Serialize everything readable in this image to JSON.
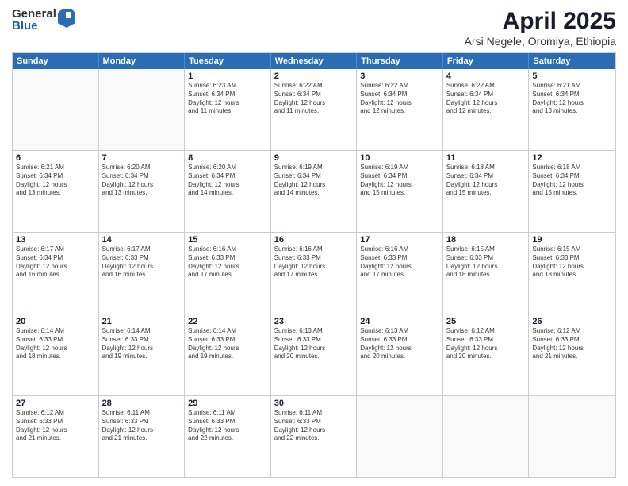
{
  "logo": {
    "general": "General",
    "blue": "Blue"
  },
  "title": "April 2025",
  "location": "Arsi Negele, Oromiya, Ethiopia",
  "header_days": [
    "Sunday",
    "Monday",
    "Tuesday",
    "Wednesday",
    "Thursday",
    "Friday",
    "Saturday"
  ],
  "weeks": [
    [
      {
        "day": "",
        "info": ""
      },
      {
        "day": "",
        "info": ""
      },
      {
        "day": "1",
        "info": "Sunrise: 6:23 AM\nSunset: 6:34 PM\nDaylight: 12 hours\nand 11 minutes."
      },
      {
        "day": "2",
        "info": "Sunrise: 6:22 AM\nSunset: 6:34 PM\nDaylight: 12 hours\nand 11 minutes."
      },
      {
        "day": "3",
        "info": "Sunrise: 6:22 AM\nSunset: 6:34 PM\nDaylight: 12 hours\nand 12 minutes."
      },
      {
        "day": "4",
        "info": "Sunrise: 6:22 AM\nSunset: 6:34 PM\nDaylight: 12 hours\nand 12 minutes."
      },
      {
        "day": "5",
        "info": "Sunrise: 6:21 AM\nSunset: 6:34 PM\nDaylight: 12 hours\nand 13 minutes."
      }
    ],
    [
      {
        "day": "6",
        "info": "Sunrise: 6:21 AM\nSunset: 6:34 PM\nDaylight: 12 hours\nand 13 minutes."
      },
      {
        "day": "7",
        "info": "Sunrise: 6:20 AM\nSunset: 6:34 PM\nDaylight: 12 hours\nand 13 minutes."
      },
      {
        "day": "8",
        "info": "Sunrise: 6:20 AM\nSunset: 6:34 PM\nDaylight: 12 hours\nand 14 minutes."
      },
      {
        "day": "9",
        "info": "Sunrise: 6:19 AM\nSunset: 6:34 PM\nDaylight: 12 hours\nand 14 minutes."
      },
      {
        "day": "10",
        "info": "Sunrise: 6:19 AM\nSunset: 6:34 PM\nDaylight: 12 hours\nand 15 minutes."
      },
      {
        "day": "11",
        "info": "Sunrise: 6:18 AM\nSunset: 6:34 PM\nDaylight: 12 hours\nand 15 minutes."
      },
      {
        "day": "12",
        "info": "Sunrise: 6:18 AM\nSunset: 6:34 PM\nDaylight: 12 hours\nand 15 minutes."
      }
    ],
    [
      {
        "day": "13",
        "info": "Sunrise: 6:17 AM\nSunset: 6:34 PM\nDaylight: 12 hours\nand 16 minutes."
      },
      {
        "day": "14",
        "info": "Sunrise: 6:17 AM\nSunset: 6:33 PM\nDaylight: 12 hours\nand 16 minutes."
      },
      {
        "day": "15",
        "info": "Sunrise: 6:16 AM\nSunset: 6:33 PM\nDaylight: 12 hours\nand 17 minutes."
      },
      {
        "day": "16",
        "info": "Sunrise: 6:16 AM\nSunset: 6:33 PM\nDaylight: 12 hours\nand 17 minutes."
      },
      {
        "day": "17",
        "info": "Sunrise: 6:16 AM\nSunset: 6:33 PM\nDaylight: 12 hours\nand 17 minutes."
      },
      {
        "day": "18",
        "info": "Sunrise: 6:15 AM\nSunset: 6:33 PM\nDaylight: 12 hours\nand 18 minutes."
      },
      {
        "day": "19",
        "info": "Sunrise: 6:15 AM\nSunset: 6:33 PM\nDaylight: 12 hours\nand 18 minutes."
      }
    ],
    [
      {
        "day": "20",
        "info": "Sunrise: 6:14 AM\nSunset: 6:33 PM\nDaylight: 12 hours\nand 18 minutes."
      },
      {
        "day": "21",
        "info": "Sunrise: 6:14 AM\nSunset: 6:33 PM\nDaylight: 12 hours\nand 19 minutes."
      },
      {
        "day": "22",
        "info": "Sunrise: 6:14 AM\nSunset: 6:33 PM\nDaylight: 12 hours\nand 19 minutes."
      },
      {
        "day": "23",
        "info": "Sunrise: 6:13 AM\nSunset: 6:33 PM\nDaylight: 12 hours\nand 20 minutes."
      },
      {
        "day": "24",
        "info": "Sunrise: 6:13 AM\nSunset: 6:33 PM\nDaylight: 12 hours\nand 20 minutes."
      },
      {
        "day": "25",
        "info": "Sunrise: 6:12 AM\nSunset: 6:33 PM\nDaylight: 12 hours\nand 20 minutes."
      },
      {
        "day": "26",
        "info": "Sunrise: 6:12 AM\nSunset: 6:33 PM\nDaylight: 12 hours\nand 21 minutes."
      }
    ],
    [
      {
        "day": "27",
        "info": "Sunrise: 6:12 AM\nSunset: 6:33 PM\nDaylight: 12 hours\nand 21 minutes."
      },
      {
        "day": "28",
        "info": "Sunrise: 6:11 AM\nSunset: 6:33 PM\nDaylight: 12 hours\nand 21 minutes."
      },
      {
        "day": "29",
        "info": "Sunrise: 6:11 AM\nSunset: 6:33 PM\nDaylight: 12 hours\nand 22 minutes."
      },
      {
        "day": "30",
        "info": "Sunrise: 6:11 AM\nSunset: 6:33 PM\nDaylight: 12 hours\nand 22 minutes."
      },
      {
        "day": "",
        "info": ""
      },
      {
        "day": "",
        "info": ""
      },
      {
        "day": "",
        "info": ""
      }
    ]
  ]
}
